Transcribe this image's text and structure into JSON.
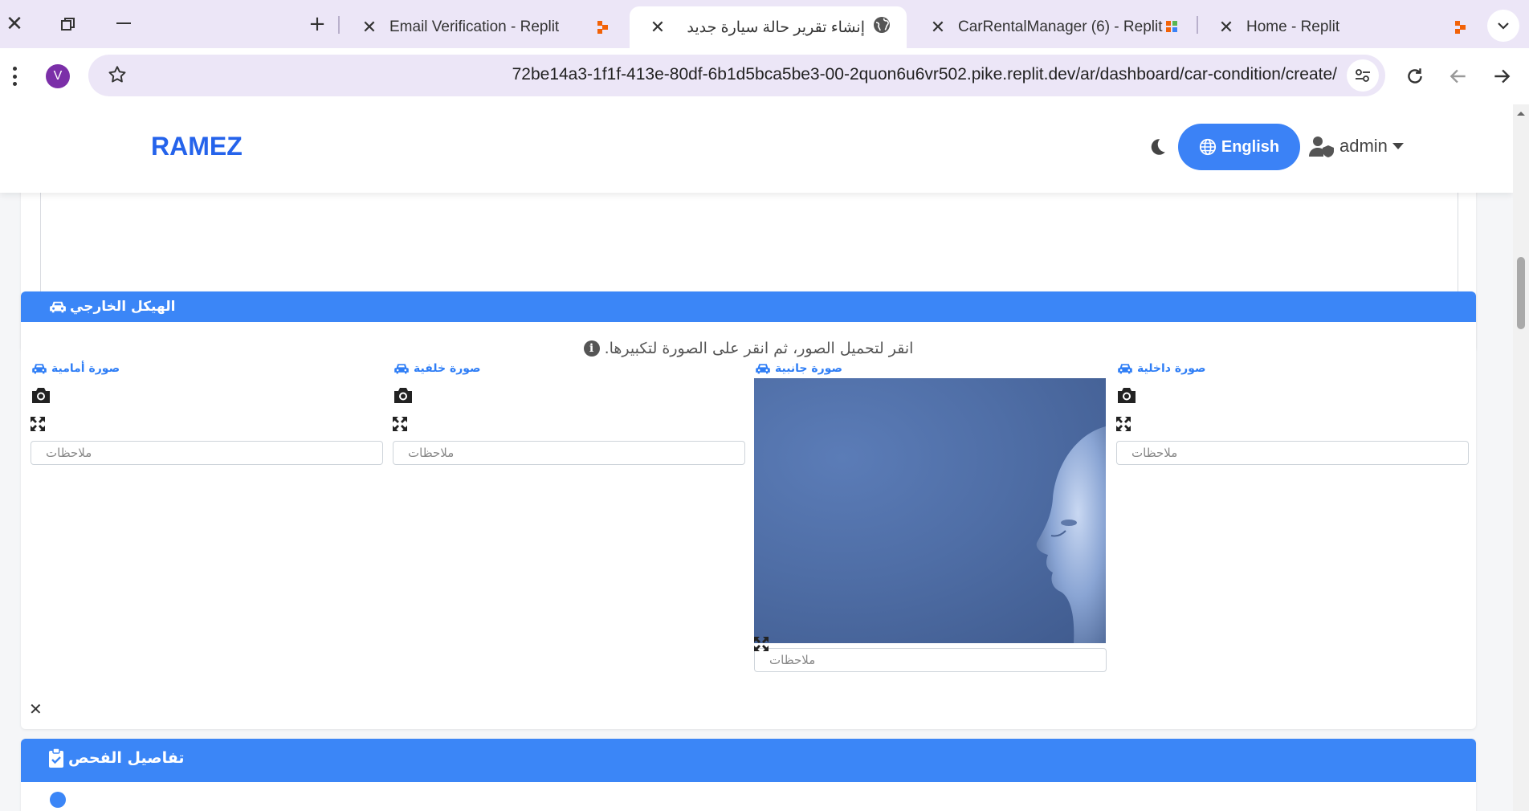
{
  "browser": {
    "tabs": [
      {
        "title": "Email Verification - Replit",
        "active": false
      },
      {
        "title": "إنشاء تقرير حالة سيارة جديد",
        "active": true
      },
      {
        "title": "CarRentalManager (6) - Replit",
        "active": false
      },
      {
        "title": "Home - Replit",
        "active": false
      }
    ],
    "url": "72be14a3-1f1f-413e-80df-6b1d5bca5be3-00-2quon6u6vr502.pike.replit.dev/ar/dashboard/car-condition/create/",
    "profile_initial": "V"
  },
  "navbar": {
    "brand": "RAMEZ",
    "language_button": "English",
    "user_menu": "admin"
  },
  "exterior_section": {
    "title": "الهيكل الخارجي",
    "hint": ".انقر لتحميل الصور، ثم انقر على الصورة لتكبيرها",
    "photos": [
      {
        "label": "صورة أمامية",
        "notes_placeholder": "ملاحظات",
        "has_image": false
      },
      {
        "label": "صورة خلفية",
        "notes_placeholder": "ملاحظات",
        "has_image": false
      },
      {
        "label": "صورة جانبية",
        "notes_placeholder": "ملاحظات",
        "has_image": true
      },
      {
        "label": "صورة داخلية",
        "notes_placeholder": "ملاحظات",
        "has_image": false
      }
    ]
  },
  "inspection_section": {
    "title": "تفاصيل الفحص"
  },
  "colors": {
    "primary": "#3b86f7",
    "brand": "#2563eb",
    "chrome_bg": "#ece6f7"
  }
}
